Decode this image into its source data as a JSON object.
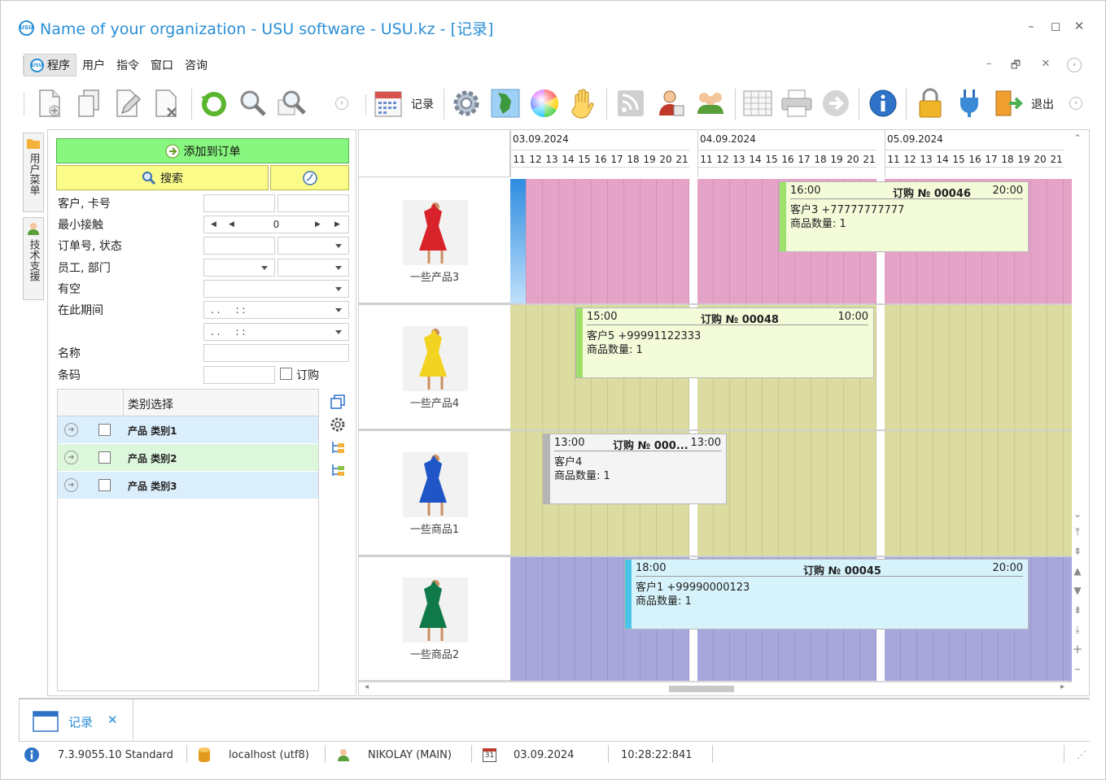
{
  "window": {
    "title": "Name of your organization - USU software - USU.kz - [记录]",
    "logo_text": "USU"
  },
  "menu": [
    "程序",
    "用户",
    "指令",
    "窗口",
    "咨询"
  ],
  "toolbar": {
    "records_label": "记录",
    "exit_label": "退出"
  },
  "side_tabs": [
    "用户菜单",
    "技术支援"
  ],
  "filter_panel": {
    "add_to_order": "添加到订单",
    "search": "搜索",
    "fields": {
      "client_card": "客户, 卡号",
      "min_contact": "最小接触",
      "min_contact_value": "0",
      "order_status": "订单号, 状态",
      "employee_dept": "员工, 部门",
      "free": "有空",
      "period": "在此期间",
      "date_mask": ". .     : :",
      "name": "名称",
      "barcode": "条码",
      "subscribe": "订购"
    },
    "category_header": "类别选择",
    "categories": [
      {
        "label": "产品 类别1",
        "color": "#dbeefc"
      },
      {
        "label": "产品 类别2",
        "color": "#dcf7dc"
      },
      {
        "label": "产品 类别3",
        "color": "#dbeefc"
      }
    ]
  },
  "schedule": {
    "days": [
      {
        "date": "03.09.2024",
        "hours": [
          "11",
          "12",
          "13",
          "14",
          "15",
          "16",
          "17",
          "18",
          "19",
          "20",
          "21"
        ]
      },
      {
        "date": "04.09.2024",
        "hours": [
          "11",
          "12",
          "13",
          "14",
          "15",
          "16",
          "17",
          "18",
          "19",
          "20",
          "21"
        ]
      },
      {
        "date": "05.09.2024",
        "hours": [
          "11",
          "12",
          "13",
          "14",
          "15",
          "16",
          "17",
          "18",
          "19",
          "20",
          "21"
        ]
      }
    ],
    "resources": [
      {
        "name": "一些产品3",
        "dress_color": "#d8232a",
        "lane_color": "#e6a3c8"
      },
      {
        "name": "一些产品4",
        "dress_color": "#f2d321",
        "lane_color": "#dcdca0"
      },
      {
        "name": "一些商品1",
        "dress_color": "#1f55c7",
        "lane_color": "#dcdca0"
      },
      {
        "name": "一些商品2",
        "dress_color": "#117a4a",
        "lane_color": "#a7a7dc"
      }
    ],
    "bookings": [
      {
        "start": "16:00",
        "order": "订购 № 00046",
        "end": "20:00",
        "client": "客户3 +77777777777",
        "qty": "商品数量: 1",
        "bg": "#f3fbd9",
        "bar": "#9ee06a"
      },
      {
        "start": "15:00",
        "order": "订购 № 00048",
        "end": "10:00",
        "client": "客户5 +99991122333",
        "qty": "商品数量: 1",
        "bg": "#f3fbd9",
        "bar": "#9ee06a"
      },
      {
        "start": "13:00",
        "order": "订购 № 000...",
        "end": "13:00",
        "client": "客户4",
        "qty": "商品数量: 1",
        "bg": "#f4f4f4",
        "bar": "#b5b5b5"
      },
      {
        "start": "18:00",
        "order": "订购 № 00045",
        "end": "20:00",
        "client": "客户1 +99990000123",
        "qty": "商品数量: 1",
        "bg": "#d6f3fb",
        "bar": "#4cc3e8"
      }
    ]
  },
  "document_tab": {
    "label": "记录"
  },
  "status": {
    "version": "7.3.9055.10 Standard",
    "db": "localhost (utf8)",
    "user": "NIKOLAY (MAIN)",
    "calendar_day": "31",
    "date": "03.09.2024",
    "time": "10:28:22:841"
  }
}
